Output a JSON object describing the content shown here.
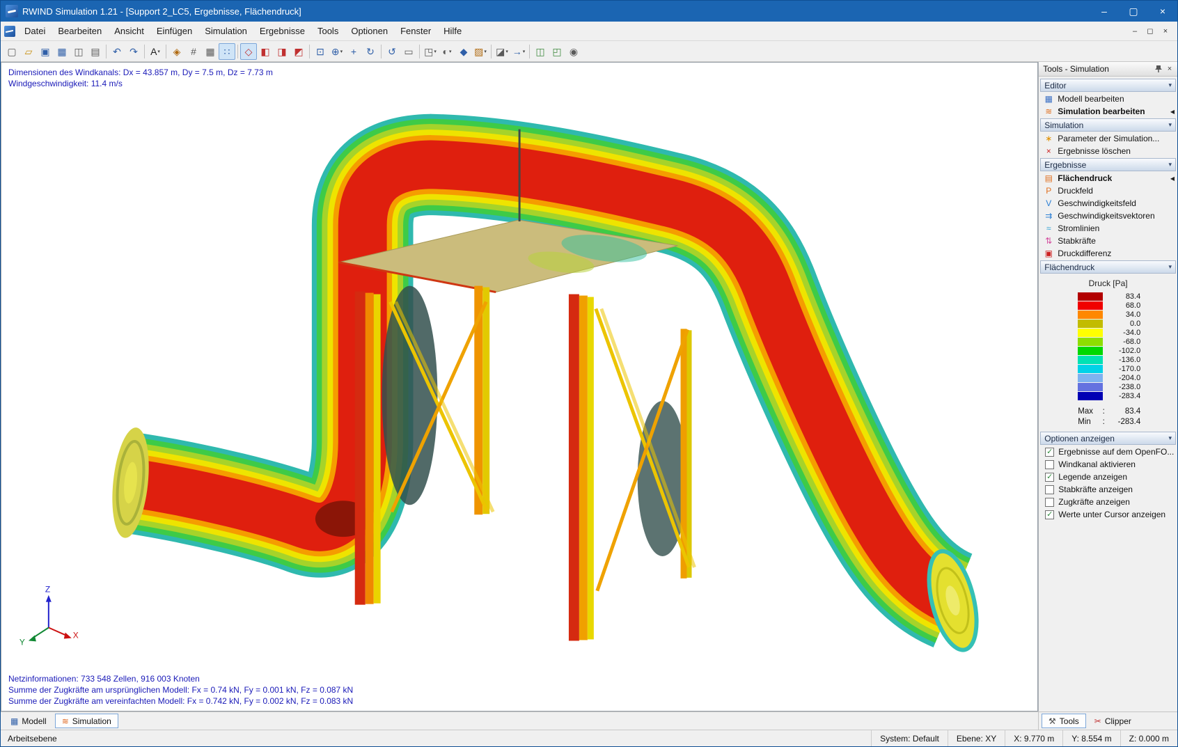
{
  "colors": {
    "titlebar_bg": "#1b65b2",
    "selection": "#cfe4f7",
    "accent_border": "#7da7d9",
    "overlay_text": "#1a1ab8"
  },
  "icons": {
    "minimize": "–",
    "maximize": "▢",
    "restore": "◻",
    "close": "×",
    "chevron_down": "▾",
    "active_marker": "◀",
    "check": "✓"
  },
  "window": {
    "title": "RWIND Simulation 1.21 - [Support 2_LC5, Ergebnisse, Flächendruck]"
  },
  "menubar": {
    "items": [
      "Datei",
      "Bearbeiten",
      "Ansicht",
      "Einfügen",
      "Simulation",
      "Ergebnisse",
      "Tools",
      "Optionen",
      "Fenster",
      "Hilfe"
    ]
  },
  "toolbar": {
    "groups": [
      {
        "icons": [
          {
            "name": "new-file-icon",
            "glyph": "▢",
            "color": "#5a5a5a"
          },
          {
            "name": "open-folder-icon",
            "glyph": "▱",
            "color": "#c89010"
          },
          {
            "name": "save-icon",
            "glyph": "▣",
            "color": "#2f5fa8"
          },
          {
            "name": "table-icon",
            "glyph": "▦",
            "color": "#2f5fa8"
          },
          {
            "name": "print-preview-icon",
            "glyph": "◫",
            "color": "#5a5a5a"
          },
          {
            "name": "print-icon",
            "glyph": "▤",
            "color": "#5a5a5a"
          }
        ]
      },
      {
        "icons": [
          {
            "name": "undo-icon",
            "glyph": "↶",
            "color": "#2f5fa8"
          },
          {
            "name": "redo-icon",
            "glyph": "↷",
            "color": "#2f5fa8"
          }
        ]
      },
      {
        "icons": [
          {
            "name": "rename-icon",
            "glyph": "A",
            "color": "#202020",
            "dropdown": true
          }
        ]
      },
      {
        "icons": [
          {
            "name": "snap-icon",
            "glyph": "◈",
            "color": "#b06a10"
          },
          {
            "name": "guidelines-icon",
            "glyph": "#",
            "color": "#5a5a5a"
          },
          {
            "name": "grid-icon",
            "glyph": "▦",
            "color": "#5a5a5a"
          },
          {
            "name": "dot-grid-icon",
            "glyph": "∷",
            "color": "#2f5fa8",
            "pressed": true
          }
        ]
      },
      {
        "icons": [
          {
            "name": "view-isometric-icon",
            "glyph": "◇",
            "color": "#c03030",
            "pressed": true
          },
          {
            "name": "view-front-icon",
            "glyph": "◧",
            "color": "#c03030"
          },
          {
            "name": "view-side-icon",
            "glyph": "◨",
            "color": "#c03030"
          },
          {
            "name": "view-top-icon",
            "glyph": "◩",
            "color": "#c03030"
          }
        ]
      },
      {
        "icons": [
          {
            "name": "zoom-window-icon",
            "glyph": "⊡",
            "color": "#2f5fa8"
          },
          {
            "name": "zoom-icon",
            "glyph": "⊕",
            "color": "#2f5fa8",
            "dropdown": true
          },
          {
            "name": "pan-icon",
            "glyph": "+",
            "color": "#2f5fa8"
          },
          {
            "name": "orbit-icon",
            "glyph": "↻",
            "color": "#2f5fa8"
          }
        ]
      },
      {
        "icons": [
          {
            "name": "previous-view-icon",
            "glyph": "↺",
            "color": "#2f5fa8"
          },
          {
            "name": "clipping-box-icon",
            "glyph": "▭",
            "color": "#5a5a5a"
          }
        ]
      },
      {
        "icons": [
          {
            "name": "workplane-icon",
            "glyph": "◳",
            "color": "#5a5a5a",
            "dropdown": true
          },
          {
            "name": "display-options-icon",
            "glyph": "◐",
            "color": "#5a5a5a",
            "dropdown": true
          },
          {
            "name": "render-mode-icon",
            "glyph": "◆",
            "color": "#2f5fa8"
          },
          {
            "name": "color-scheme-icon",
            "glyph": "▨",
            "color": "#b06a10",
            "dropdown": true
          }
        ]
      },
      {
        "icons": [
          {
            "name": "section-plane-icon",
            "glyph": "◪",
            "color": "#5a5a5a",
            "dropdown": true
          },
          {
            "name": "result-arrow-icon",
            "glyph": "→",
            "color": "#2f5fa8",
            "dropdown": true
          }
        ]
      },
      {
        "icons": [
          {
            "name": "cascade-windows-icon",
            "glyph": "◫",
            "color": "#3f8a3f"
          },
          {
            "name": "tile-windows-icon",
            "glyph": "◰",
            "color": "#3f8a3f"
          },
          {
            "name": "screenshot-icon",
            "glyph": "◉",
            "color": "#5a5a5a"
          }
        ]
      }
    ]
  },
  "viewport": {
    "overlay_top": [
      "Dimensionen des Windkanals: Dx = 43.857 m, Dy = 7.5 m, Dz = 7.73 m",
      "Windgeschwindigkeit: 11.4 m/s"
    ],
    "overlay_bottom": [
      "Netzinformationen: 733 548 Zellen, 916 003 Knoten",
      "Summe der Zugkräfte am ursprünglichen Modell: Fx = 0.74 kN, Fy = 0.001 kN, Fz = 0.087 kN",
      "Summe der Zugkräfte am vereinfachten Modell: Fx = 0.742 kN, Fy = 0.002 kN, Fz = 0.083 kN"
    ],
    "axes": {
      "x": "X",
      "y": "Y",
      "z": "Z"
    }
  },
  "tools_panel": {
    "title": "Tools - Simulation",
    "sections": {
      "editor": {
        "title": "Editor",
        "items": [
          {
            "label": "Modell bearbeiten",
            "icon": "edit-model-icon",
            "glyph": "▦",
            "color": "#3a6fc4"
          },
          {
            "label": "Simulation bearbeiten",
            "icon": "edit-simulation-icon",
            "glyph": "≋",
            "color": "#e07020",
            "bold": true,
            "active": true
          }
        ]
      },
      "simulation": {
        "title": "Simulation",
        "items": [
          {
            "label": "Parameter der Simulation...",
            "icon": "simulation-parameters-icon",
            "glyph": "∗",
            "color": "#e09000"
          },
          {
            "label": "Ergebnisse löschen",
            "icon": "delete-results-icon",
            "glyph": "×",
            "color": "#cc2020"
          }
        ]
      },
      "ergebnisse": {
        "title": "Ergebnisse",
        "items": [
          {
            "label": "Flächendruck",
            "icon": "surface-pressure-icon",
            "glyph": "▤",
            "color": "#e07020",
            "bold": true,
            "active": true
          },
          {
            "label": "Druckfeld",
            "icon": "pressure-field-icon",
            "glyph": "P",
            "color": "#e07020"
          },
          {
            "label": "Geschwindigkeitsfeld",
            "icon": "velocity-field-icon",
            "glyph": "V",
            "color": "#2b7fd4"
          },
          {
            "label": "Geschwindigkeitsvektoren",
            "icon": "velocity-vectors-icon",
            "glyph": "⇉",
            "color": "#2b7fd4"
          },
          {
            "label": "Stromlinien",
            "icon": "streamlines-icon",
            "glyph": "≈",
            "color": "#2b9fd4"
          },
          {
            "label": "Stabkräfte",
            "icon": "member-forces-icon",
            "glyph": "⇅",
            "color": "#d44fa0"
          },
          {
            "label": "Druckdifferenz",
            "icon": "pressure-difference-icon",
            "glyph": "▣",
            "color": "#cc2020"
          }
        ]
      },
      "flaechendruck": {
        "title": "Flächendruck"
      },
      "optionen": {
        "title": "Optionen anzeigen"
      }
    },
    "legend": {
      "title": "Druck [Pa]",
      "colon": ":",
      "entries": [
        {
          "color": "#b20000",
          "label": "83.4"
        },
        {
          "color": "#f00000",
          "label": "68.0"
        },
        {
          "color": "#ff8800",
          "label": "34.0"
        },
        {
          "color": "#c2bc00",
          "label": "0.0"
        },
        {
          "color": "#ffff00",
          "label": "-34.0"
        },
        {
          "color": "#8ede00",
          "label": "-68.0"
        },
        {
          "color": "#00d800",
          "label": "-102.0"
        },
        {
          "color": "#00e2b4",
          "label": "-136.0"
        },
        {
          "color": "#00d2e8",
          "label": "-170.0"
        },
        {
          "color": "#7eb2f0",
          "label": "-204.0"
        },
        {
          "color": "#6472e0",
          "label": "-238.0"
        },
        {
          "color": "#0000b4",
          "label": "-283.4"
        }
      ],
      "max": {
        "label": "Max",
        "value": "83.4"
      },
      "min": {
        "label": "Min",
        "value": "-283.4"
      }
    },
    "options": [
      {
        "label": "Ergebnisse auf dem OpenFO...",
        "checked": true
      },
      {
        "label": "Windkanal aktivieren",
        "checked": false
      },
      {
        "label": "Legende anzeigen",
        "checked": true
      },
      {
        "label": "Stabkräfte anzeigen",
        "checked": false
      },
      {
        "label": "Zugkräfte anzeigen",
        "checked": false
      },
      {
        "label": "Werte unter Cursor anzeigen",
        "checked": true
      }
    ]
  },
  "bottom_tabs": [
    {
      "label": "Modell",
      "glyph": "▦"
    },
    {
      "label": "Simulation",
      "glyph": "≋"
    }
  ],
  "panel_tabs": [
    {
      "label": "Tools",
      "glyph": "⚒"
    },
    {
      "label": "Clipper",
      "glyph": "✂"
    }
  ],
  "statusbar": {
    "left": "Arbeitsebene",
    "cells": [
      "System: Default",
      "Ebene: XY",
      "X:  9.770 m",
      "Y:  8.554 m",
      "Z:  0.000 m"
    ]
  }
}
